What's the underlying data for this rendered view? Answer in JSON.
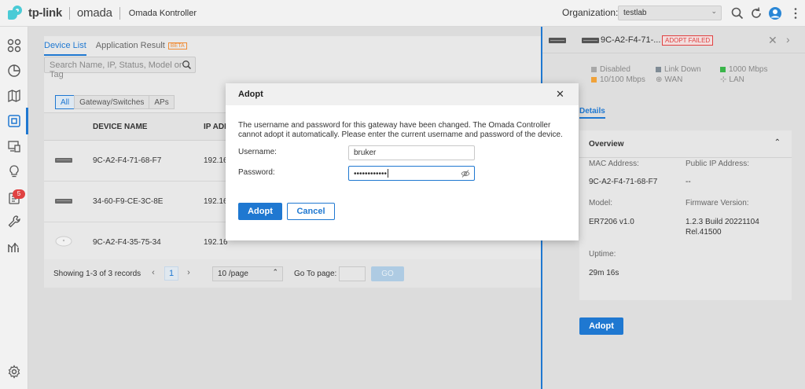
{
  "topbar": {
    "brand": "tp-link",
    "product": "omada",
    "app_title": "Omada Kontroller",
    "org_label": "Organization:",
    "org_value": "testlab"
  },
  "rail": {
    "badge_count": "5"
  },
  "device_list": {
    "tabs": [
      {
        "label": "Device List"
      },
      {
        "label": "Application Result"
      }
    ],
    "beta_label": "BETA",
    "search_placeholder": "Search Name, IP, Status, Model or Tag",
    "filters": [
      "All",
      "Gateway/Switches",
      "APs"
    ],
    "columns": [
      "DEVICE NAME",
      "IP ADD"
    ],
    "rows": [
      {
        "name": "9C-A2-F4-71-68-F7",
        "ip": "192.16"
      },
      {
        "name": "34-60-F9-CE-3C-8E",
        "ip": "192.16"
      },
      {
        "name": "9C-A2-F4-35-75-34",
        "ip": "192.16"
      }
    ],
    "pager": {
      "summary": "Showing 1-3 of 3 records",
      "prev": "‹",
      "current": "1",
      "next": "›",
      "page_size": "10 /page",
      "goto_label": "Go To page:",
      "go_label": "GO"
    }
  },
  "detail": {
    "title": "9C-A2-F4-71-...",
    "status": "ADOPT FAILED",
    "legend": {
      "disabled": "Disabled",
      "link_down": "Link Down",
      "gbps": "1000 Mbps",
      "mbps": "10/100 Mbps",
      "wan": "WAN",
      "lan": "LAN"
    },
    "colors": {
      "disabled": "#a8a8a8",
      "link_down": "#808c96",
      "gbps": "#3ab54a",
      "mbps": "#f0a23a"
    },
    "tab": "Details",
    "overview": {
      "title": "Overview",
      "mac_label": "MAC Address:",
      "mac_value": "9C-A2-F4-71-68-F7",
      "public_ip_label": "Public IP Address:",
      "public_ip_value": "--",
      "model_label": "Model:",
      "model_value": "ER7206 v1.0",
      "firmware_label": "Firmware Version:",
      "firmware_value_1": "1.2.3 Build 20221104",
      "firmware_value_2": "Rel.41500",
      "uptime_label": "Uptime:",
      "uptime_value": "29m 16s"
    },
    "adopt_button": "Adopt"
  },
  "modal": {
    "title": "Adopt",
    "message": "The username and password for this gateway have been changed. The Omada Controller cannot adopt it automatically. Please enter the current username and password of the device.",
    "username_label": "Username:",
    "username_value": "bruker",
    "password_label": "Password:",
    "password_value": "••••••••••••",
    "adopt_label": "Adopt",
    "cancel_label": "Cancel"
  },
  "accent_color": "#1f78d1"
}
